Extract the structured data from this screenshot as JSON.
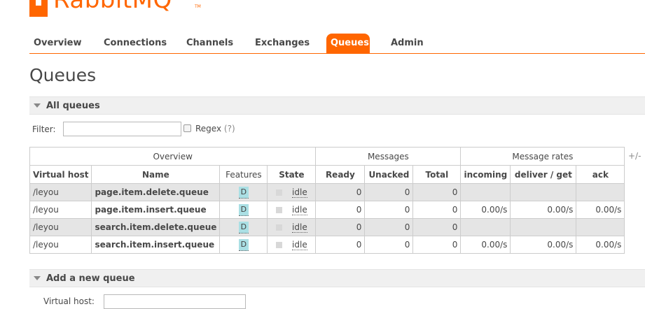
{
  "brand": {
    "logo_text": "RabbitMQ",
    "tm": "TM",
    "accent": "#ff6600"
  },
  "nav": {
    "tabs": [
      {
        "label": "Overview"
      },
      {
        "label": "Connections"
      },
      {
        "label": "Channels"
      },
      {
        "label": "Exchanges"
      },
      {
        "label": "Queues",
        "active": true
      },
      {
        "label": "Admin"
      }
    ]
  },
  "page": {
    "title": "Queues"
  },
  "all_queues": {
    "section_title": "All queues",
    "filter_label": "Filter:",
    "filter_value": "",
    "regex_label": "Regex",
    "regex_help": "(?)",
    "regex_checked": false,
    "plus_minus": "+/-",
    "groups": {
      "overview": "Overview",
      "messages": "Messages",
      "rates": "Message rates"
    },
    "columns": {
      "vhost": "Virtual host",
      "name": "Name",
      "features": "Features",
      "state": "State",
      "ready": "Ready",
      "unacked": "Unacked",
      "total": "Total",
      "incoming": "incoming",
      "deliver_get": "deliver / get",
      "ack": "ack"
    },
    "rows": [
      {
        "vhost": "/leyou",
        "name": "page.item.delete.queue",
        "feature": "D",
        "state": "idle",
        "ready": "0",
        "unacked": "0",
        "total": "0",
        "incoming": "",
        "deliver_get": "",
        "ack": ""
      },
      {
        "vhost": "/leyou",
        "name": "page.item.insert.queue",
        "feature": "D",
        "state": "idle",
        "ready": "0",
        "unacked": "0",
        "total": "0",
        "incoming": "0.00/s",
        "deliver_get": "0.00/s",
        "ack": "0.00/s"
      },
      {
        "vhost": "/leyou",
        "name": "search.item.delete.queue",
        "feature": "D",
        "state": "idle",
        "ready": "0",
        "unacked": "0",
        "total": "0",
        "incoming": "",
        "deliver_get": "",
        "ack": ""
      },
      {
        "vhost": "/leyou",
        "name": "search.item.insert.queue",
        "feature": "D",
        "state": "idle",
        "ready": "0",
        "unacked": "0",
        "total": "0",
        "incoming": "0.00/s",
        "deliver_get": "0.00/s",
        "ack": "0.00/s"
      }
    ]
  },
  "add_queue": {
    "section_title": "Add a new queue",
    "first_field_label": "Virtual host:"
  }
}
